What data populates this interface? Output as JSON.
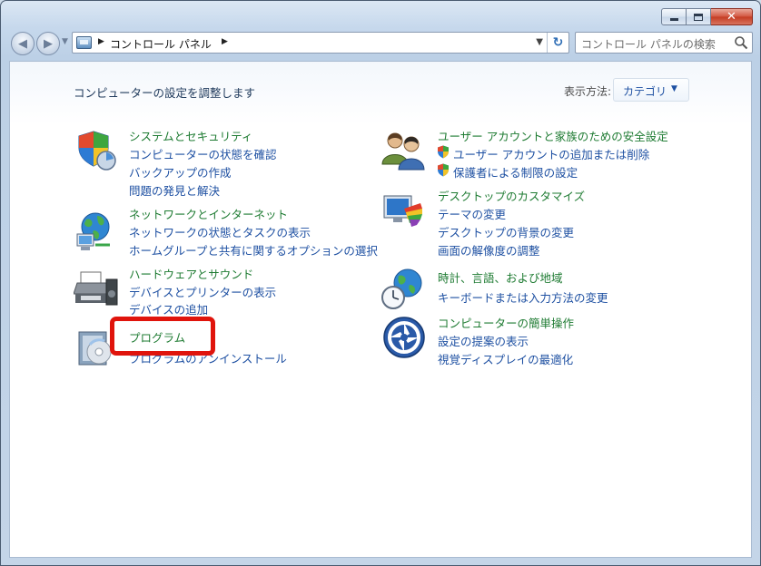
{
  "window": {
    "controls": {
      "minimize": "minimize",
      "maximize": "maximize",
      "close": "close"
    },
    "colors": {
      "link": "#1e50a2",
      "category": "#1e7b32",
      "highlight": "#e0140c"
    }
  },
  "address_bar": {
    "breadcrumb": "コントロール パネル"
  },
  "search": {
    "placeholder": "コントロール パネルの検索"
  },
  "content": {
    "heading": "コンピューターの設定を調整します",
    "view_by_label": "表示方法:",
    "view_by_value": "カテゴリ"
  },
  "categories": {
    "system_security": {
      "title": "システムとセキュリティ",
      "links": [
        "コンピューターの状態を確認",
        "バックアップの作成",
        "問題の発見と解決"
      ]
    },
    "network_internet": {
      "title": "ネットワークとインターネット",
      "links": [
        "ネットワークの状態とタスクの表示",
        "ホームグループと共有に関するオプションの選択"
      ]
    },
    "hardware_sound": {
      "title": "ハードウェアとサウンド",
      "links": [
        "デバイスとプリンターの表示",
        "デバイスの追加"
      ]
    },
    "programs": {
      "title": "プログラム",
      "links": [
        "プログラムのアンインストール"
      ]
    },
    "user_accounts": {
      "title": "ユーザー アカウントと家族のための安全設定",
      "links": [
        "ユーザー アカウントの追加または削除",
        "保護者による制限の設定"
      ]
    },
    "appearance": {
      "title": "デスクトップのカスタマイズ",
      "links": [
        "テーマの変更",
        "デスクトップの背景の変更",
        "画面の解像度の調整"
      ]
    },
    "clock_region": {
      "title": "時計、言語、および地域",
      "links": [
        "キーボードまたは入力方法の変更"
      ]
    },
    "ease_of_access": {
      "title": "コンピューターの簡単操作",
      "links": [
        "設定の提案の表示",
        "視覚ディスプレイの最適化"
      ]
    }
  }
}
